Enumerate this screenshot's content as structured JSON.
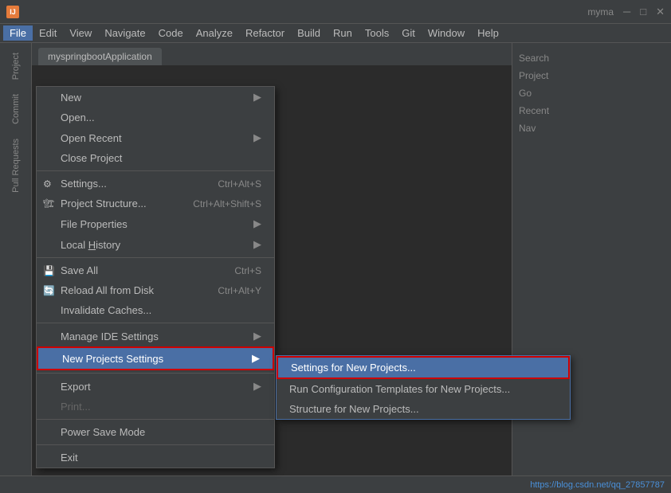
{
  "titlebar": {
    "app_name": "myma",
    "icon_text": "IJ"
  },
  "menubar": {
    "items": [
      {
        "label": "File",
        "active": true
      },
      {
        "label": "Edit"
      },
      {
        "label": "View"
      },
      {
        "label": "Navigate"
      },
      {
        "label": "Code"
      },
      {
        "label": "Analyze"
      },
      {
        "label": "Refactor"
      },
      {
        "label": "Build"
      },
      {
        "label": "Run"
      },
      {
        "label": "Tools"
      },
      {
        "label": "Git"
      },
      {
        "label": "Window"
      },
      {
        "label": "Help"
      }
    ]
  },
  "file_menu": {
    "items": [
      {
        "label": "New",
        "has_arrow": true,
        "shortcut": "",
        "icon": ""
      },
      {
        "label": "Open...",
        "shortcut": "",
        "icon": ""
      },
      {
        "label": "Open Recent",
        "has_arrow": true,
        "shortcut": "",
        "icon": ""
      },
      {
        "label": "Close Project",
        "shortcut": "",
        "icon": ""
      },
      {
        "label": "separator1"
      },
      {
        "label": "Settings...",
        "shortcut": "Ctrl+Alt+S",
        "icon": "⚙"
      },
      {
        "label": "Project Structure...",
        "shortcut": "Ctrl+Alt+Shift+S",
        "icon": "📁"
      },
      {
        "label": "File Properties",
        "has_arrow": true,
        "shortcut": "",
        "icon": ""
      },
      {
        "label": "Local History",
        "has_arrow": true,
        "shortcut": "",
        "icon": ""
      },
      {
        "label": "separator2"
      },
      {
        "label": "Save All",
        "shortcut": "Ctrl+S",
        "icon": "💾"
      },
      {
        "label": "Reload All from Disk",
        "shortcut": "Ctrl+Alt+Y",
        "icon": "🔄"
      },
      {
        "label": "Invalidate Caches...",
        "shortcut": "",
        "icon": ""
      },
      {
        "label": "separator3"
      },
      {
        "label": "Manage IDE Settings",
        "has_arrow": true,
        "highlighted": false
      },
      {
        "label": "New Projects Settings",
        "has_arrow": true,
        "highlighted": true,
        "red_border": true
      },
      {
        "label": "separator4"
      },
      {
        "label": "Export",
        "has_arrow": true
      },
      {
        "label": "Print...",
        "disabled": true
      },
      {
        "label": "separator5"
      },
      {
        "label": "Power Save Mode"
      },
      {
        "label": "separator6"
      },
      {
        "label": "Exit"
      }
    ]
  },
  "new_projects_submenu": {
    "items": [
      {
        "label": "Settings for New Projects...",
        "highlighted": true,
        "red_border": true
      },
      {
        "label": "Run Configuration Templates for New Projects..."
      },
      {
        "label": "Structure for New Projects..."
      }
    ]
  },
  "editor": {
    "tab_label": "myspringbootApplication"
  },
  "right_panel": {
    "items": [
      {
        "label": "Search"
      },
      {
        "label": "Project"
      },
      {
        "label": "Go"
      },
      {
        "label": "Recent"
      },
      {
        "label": "Nav"
      }
    ]
  },
  "sidebar_tabs": [
    {
      "label": "Project"
    },
    {
      "label": "Commit"
    },
    {
      "label": "Pull Requests"
    }
  ],
  "bottom_bar": {
    "url_text": "https://blog.csdn.net/qq_27857787"
  }
}
